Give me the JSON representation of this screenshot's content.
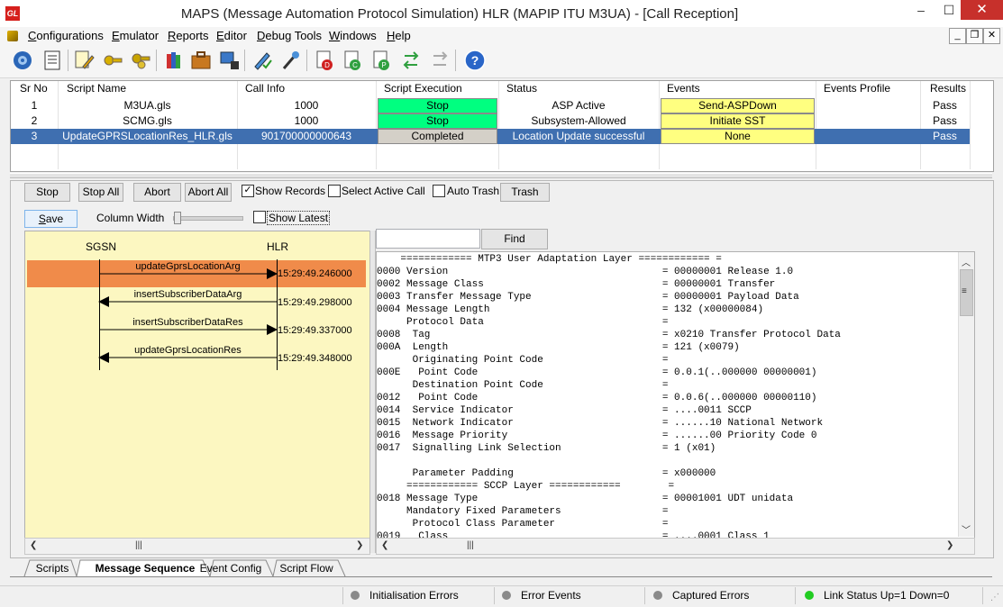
{
  "window": {
    "title": "MAPS (Message Automation Protocol Simulation) HLR (MAPIP ITU M3UA) - [Call Reception]",
    "app_icon_text": "GL",
    "controls": {
      "minimize": "–",
      "maximize": "☐",
      "close": "✕"
    }
  },
  "menu": {
    "items": [
      "Configurations",
      "Emulator",
      "Reports",
      "Editor",
      "Debug Tools",
      "Windows",
      "Help"
    ],
    "mdi": {
      "minimize": "_",
      "restore": "❐",
      "close": "✕"
    }
  },
  "toolbar": {
    "icons": [
      "gear-icon",
      "notebook-icon",
      "script-edit-icon",
      "keys-icon",
      "keys2-icon",
      "books-icon",
      "briefcase-icon",
      "monitor-lock-icon",
      "pen-check-icon",
      "wand-icon",
      "doc-d-icon",
      "doc-c-icon",
      "doc-p-icon",
      "import-export-icon",
      "disabled-export-icon",
      "help-icon"
    ]
  },
  "script_table": {
    "headers": [
      "Sr No",
      "Script Name",
      "Call Info",
      "Script Execution",
      "Status",
      "Events",
      "Events Profile",
      "Results"
    ],
    "rows": [
      {
        "sr": "1",
        "name": "M3UA.gls",
        "call_info": "1000",
        "exec": "Stop",
        "status": "ASP Active",
        "event": "Send-ASPDown",
        "profile": "",
        "result": "Pass"
      },
      {
        "sr": "2",
        "name": "SCMG.gls",
        "call_info": "1000",
        "exec": "Stop",
        "status": "Subsystem-Allowed",
        "event": "Initiate SST",
        "profile": "",
        "result": "Pass"
      },
      {
        "sr": "3",
        "name": "UpdateGPRSLocationRes_HLR.gls",
        "call_info": "901700000000643",
        "exec": "Completed",
        "status": "Location Update successful",
        "event": "None",
        "profile": "",
        "result": "Pass"
      }
    ],
    "colors": {
      "stop": "#00ff80",
      "event": "#ffff80",
      "completed": "#d4d0c8",
      "selected": "#3f6fb0"
    }
  },
  "controls": {
    "stop": "Stop",
    "stop_all": "Stop All",
    "abort": "Abort",
    "abort_all": "Abort All",
    "show_records": "Show Records",
    "show_records_checked": "✓",
    "select_active_call": "Select Active Call",
    "auto_trash": "Auto Trash",
    "trash": "Trash",
    "save": "Save",
    "column_width": "Column Width",
    "show_latest": "Show Latest"
  },
  "sequence": {
    "left_node": "SGSN",
    "right_node": "HLR",
    "messages": [
      {
        "label": "updateGprsLocationArg",
        "time": "15:29:49.246000",
        "direction": "right"
      },
      {
        "label": "insertSubscriberDataArg",
        "time": "15:29:49.298000",
        "direction": "left"
      },
      {
        "label": "insertSubscriberDataRes",
        "time": "15:29:49.337000",
        "direction": "right"
      },
      {
        "label": "updateGprsLocationRes",
        "time": "15:29:49.348000",
        "direction": "left"
      }
    ],
    "highlight_color": "#f08b4a"
  },
  "decode": {
    "find_label": "Find",
    "find_value": "",
    "lines": [
      "    ============ MTP3 User Adaptation Layer ============ =",
      "0000 Version                                    = 00000001 Release 1.0",
      "0002 Message Class                              = 00000001 Transfer",
      "0003 Transfer Message Type                      = 00000001 Payload Data",
      "0004 Message Length                             = 132 (x00000084)",
      "     Protocol Data                              =",
      "0008  Tag                                       = x0210 Transfer Protocol Data",
      "000A  Length                                    = 121 (x0079)",
      "      Originating Point Code                    =",
      "000E   Point Code                               = 0.0.1(..000000 00000001)",
      "      Destination Point Code                    =",
      "0012   Point Code                               = 0.0.6(..000000 00000110)",
      "0014  Service Indicator                         = ....0011 SCCP",
      "0015  Network Indicator                         = ......10 National Network",
      "0016  Message Priority                          = ......00 Priority Code 0",
      "0017  Signalling Link Selection                 = 1 (x01)",
      "",
      "      Parameter Padding                         = x000000",
      "     ============ SCCP Layer ============        =",
      "0018 Message Type                               = 00001001 UDT unidata",
      "     Mandatory Fixed Parameters                 =",
      "      Protocol Class Parameter                  =",
      "0019   Class                                    = ....0001 Class 1"
    ]
  },
  "tabs": [
    "Scripts",
    "Message Sequence",
    "Event Config",
    "Script Flow"
  ],
  "active_tab": "Message Sequence",
  "status": {
    "initialisation_errors": "Initialisation Errors",
    "error_events": "Error Events",
    "captured_errors": "Captured Errors",
    "link_status": "Link Status Up=1 Down=0",
    "link_color": "#22cc22",
    "idle_color": "#8a8a8a"
  }
}
